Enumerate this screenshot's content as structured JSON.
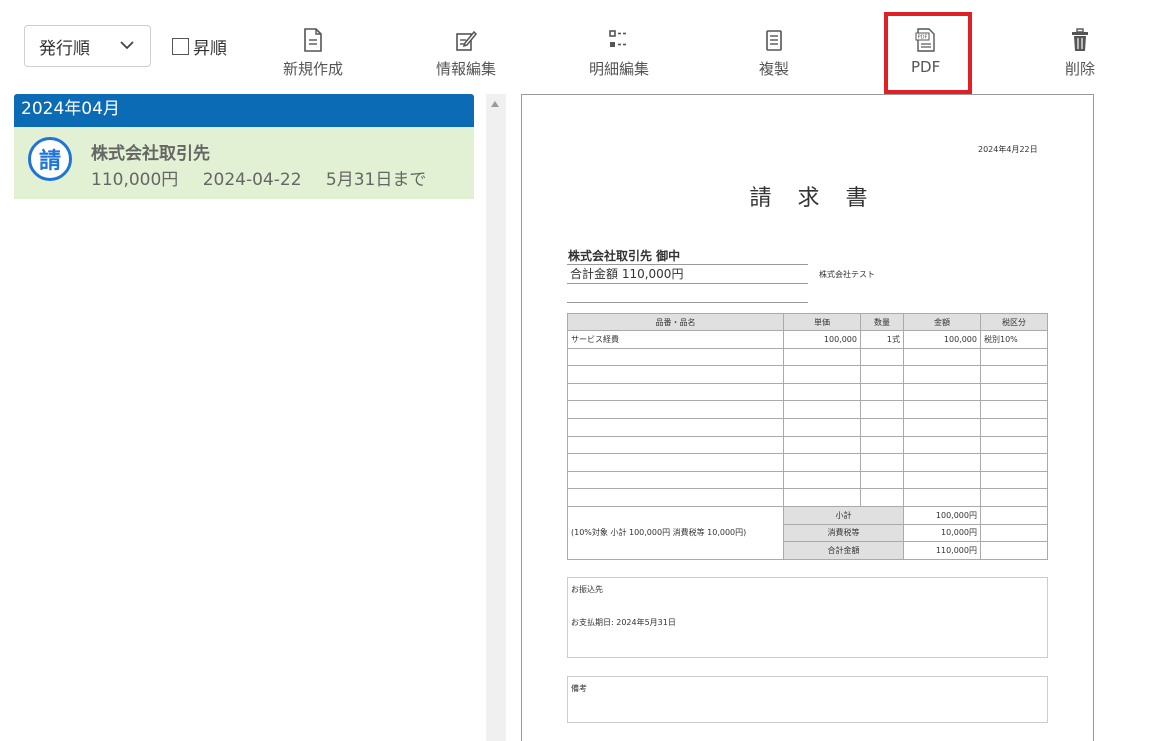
{
  "toolbar": {
    "sort_value": "発行順",
    "asc_label": "昇順",
    "new_label": "新規作成",
    "info_edit_label": "情報編集",
    "detail_edit_label": "明細編集",
    "copy_label": "複製",
    "pdf_label": "PDF",
    "delete_label": "削除",
    "highlight_color": "#e01f26"
  },
  "list": {
    "month_header": "2024年04月",
    "header_color": "#0b6bb5",
    "items": [
      {
        "icon_char": "請",
        "title": "株式会社取引先",
        "amount": "110,000円",
        "date": "2024-04-22",
        "due": "5月31日まで"
      }
    ]
  },
  "doc": {
    "date": "2024年4月22日",
    "title": "請求書",
    "recipient": "株式会社取引先 御中",
    "total": "合計金額 110,000円",
    "issuer": "株式会社テスト",
    "headers": [
      "品番・品名",
      "単価",
      "数量",
      "金額",
      "税区分"
    ],
    "rows": [
      [
        "サービス経費",
        "100,000",
        "1式",
        "100,000",
        "税別10%"
      ]
    ],
    "tax_note": "(10%対象 小計 100,000円 消費税等 10,000円)",
    "subtotal_label": "小計",
    "subtotal_value": "100,000円",
    "tax_label": "消費税等",
    "tax_value": "10,000円",
    "grand_label": "合計金額",
    "grand_value": "110,000円",
    "bank_label": "お振込先",
    "due_text": "お支払期日: 2024年5月31日",
    "remarks_label": "備考"
  }
}
